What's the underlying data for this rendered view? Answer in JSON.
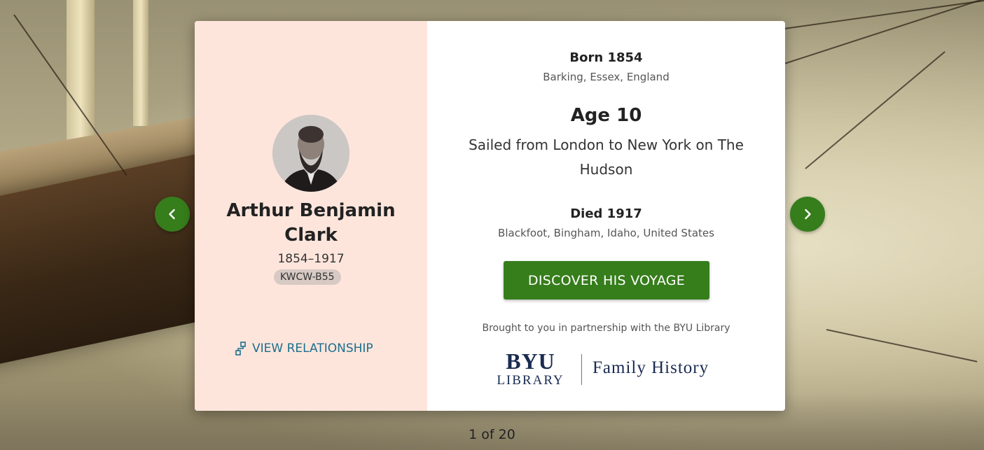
{
  "person": {
    "name": "Arthur Benjamin Clark",
    "years": "1854–1917",
    "pid": "KWCW-B55",
    "relationship_label": "VIEW RELATIONSHIP"
  },
  "born": {
    "label": "Born 1854",
    "place": "Barking, Essex, England"
  },
  "voyage": {
    "age_label": "Age 10",
    "description": "Sailed from London to New York on The Hudson",
    "cta_label": "DISCOVER HIS VOYAGE"
  },
  "died": {
    "label": "Died 1917",
    "place": "Blackfoot, Bingham, Idaho, United States"
  },
  "partner": {
    "text": "Brought to you in partnership with the BYU Library",
    "logo_line1": "BYU",
    "logo_line2": "LIBRARY",
    "logo_right": "Family History"
  },
  "pager": {
    "text": "1 of 20"
  },
  "icons": {
    "prev": "chevron-left-icon",
    "next": "chevron-right-icon",
    "relationship": "relationship-icon"
  },
  "colors": {
    "accent": "#367d1b",
    "left_panel": "#fee5dc",
    "link": "#1a6f8c",
    "logo": "#1a2b52"
  }
}
